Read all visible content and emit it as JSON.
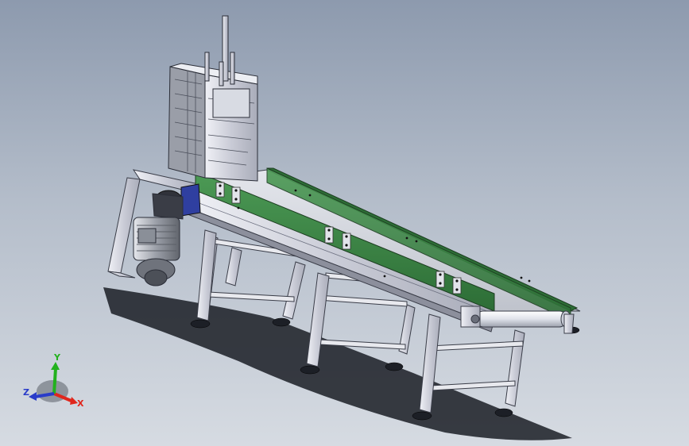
{
  "viewport": {
    "background_top": "#8d9aae",
    "background_bottom": "#d6dbe2"
  },
  "model": {
    "frame_color": "#dcdde6",
    "belt_side_color": "#3f8a49",
    "motor_color": "#9ea2aa",
    "drive_hub_color": "#2f3fa0",
    "shadow_color": "#1a1d24"
  },
  "triad": {
    "x_label": "X",
    "y_label": "Y",
    "z_label": "Z",
    "x_color": "#e0261c",
    "y_color": "#22b11d",
    "z_color": "#2a3cc9"
  }
}
